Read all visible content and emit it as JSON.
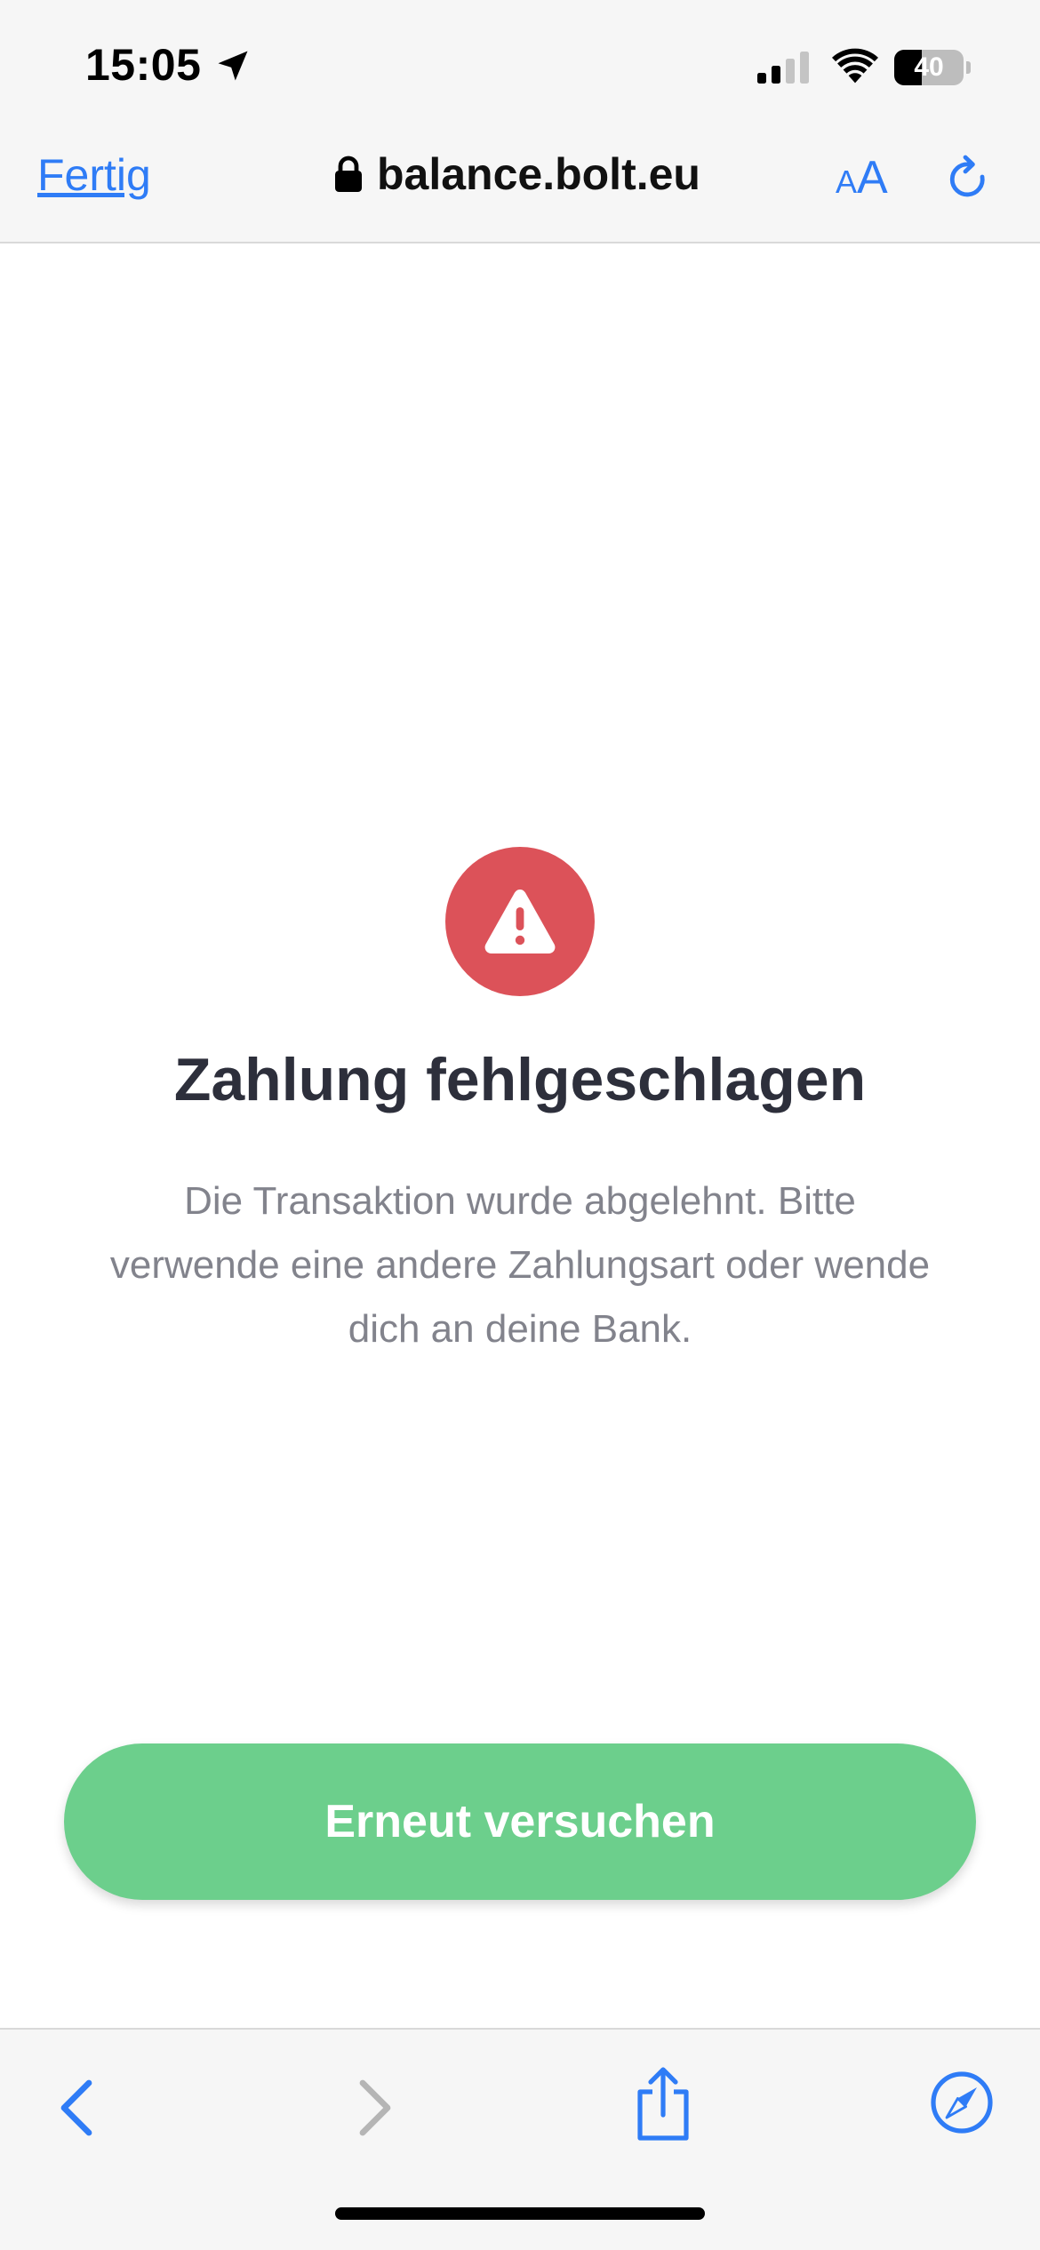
{
  "status_bar": {
    "time": "15:05",
    "battery_percent": 40,
    "battery_label": "40"
  },
  "browser": {
    "done_label": "Fertig",
    "url": "balance.bolt.eu",
    "text_size_small": "A",
    "text_size_large": "A"
  },
  "content": {
    "title": "Zahlung fehlgeschlagen",
    "message": "Die Transaktion wurde abgelehnt. Bitte verwende eine andere Zahlungsart oder wende dich an deine Bank.",
    "retry_label": "Erneut versuchen"
  },
  "colors": {
    "accent": "#2f7cf6",
    "error": "#dc5259",
    "success_button": "#6ccf8c",
    "title": "#2d2f3b",
    "message": "#82838c"
  },
  "icons": {
    "location": "location-arrow-icon",
    "signal": "cellular-signal-icon",
    "wifi": "wifi-icon",
    "lock": "lock-icon",
    "reload": "reload-icon",
    "alert": "warning-triangle-icon",
    "back": "chevron-left-icon",
    "forward": "chevron-right-icon",
    "share": "share-icon",
    "compass": "compass-icon"
  }
}
